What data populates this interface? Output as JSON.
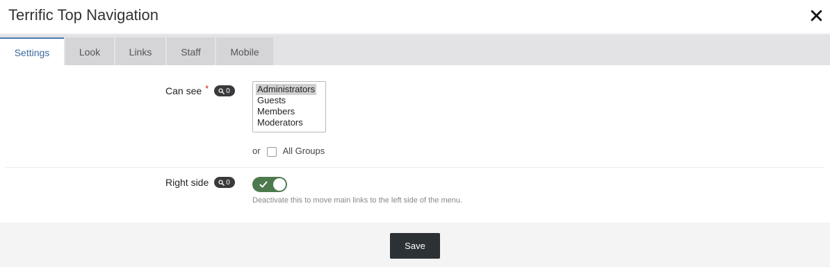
{
  "dialog": {
    "title": "Terrific Top Navigation",
    "close_icon": "close-icon"
  },
  "tabs": [
    {
      "label": "Settings",
      "active": true
    },
    {
      "label": "Look",
      "active": false
    },
    {
      "label": "Links",
      "active": false
    },
    {
      "label": "Staff",
      "active": false
    },
    {
      "label": "Mobile",
      "active": false
    }
  ],
  "can_see": {
    "label": "Can see",
    "required_mark": "*",
    "badge_icon": "search-icon",
    "badge_count": "0",
    "options": [
      {
        "label": "Administrators",
        "selected": true
      },
      {
        "label": "Guests",
        "selected": false
      },
      {
        "label": "Members",
        "selected": false
      },
      {
        "label": "Moderators",
        "selected": false
      }
    ],
    "or_text": "or",
    "all_groups_label": "All Groups",
    "all_groups_checked": false
  },
  "right_side": {
    "label": "Right side",
    "badge_icon": "search-icon",
    "badge_count": "0",
    "enabled": true,
    "hint": "Deactivate this to move main links to the left side of the menu."
  },
  "footer": {
    "save_label": "Save"
  },
  "colors": {
    "active_tab_text": "#3c6a9c",
    "toggle_on": "#4d7a4d",
    "save_button": "#2c3136",
    "required": "#cc2222"
  }
}
